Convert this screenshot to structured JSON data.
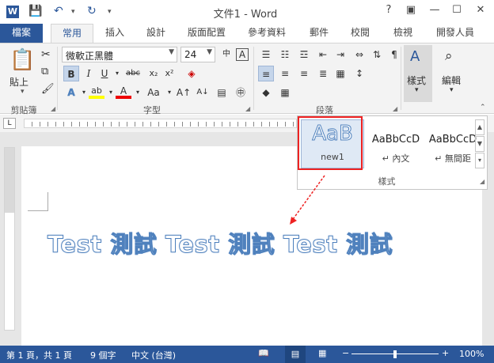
{
  "titlebar": {
    "app_icon": "W",
    "title": "文件1 - Word",
    "help": "?"
  },
  "tabs": [
    "檔案",
    "常用",
    "插入",
    "設計",
    "版面配置",
    "參考資料",
    "郵件",
    "校閱",
    "檢視",
    "開發人員"
  ],
  "clipboard": {
    "paste_label": "貼上",
    "group_label": "剪貼簿"
  },
  "font": {
    "name": "微軟正黑體",
    "size": "24",
    "group_label": "字型",
    "bold": "B",
    "italic": "I",
    "underline": "U",
    "strike": "abc",
    "sub": "x₂",
    "sup": "x²",
    "change_case": "Aa",
    "font_glyph": "A"
  },
  "paragraph": {
    "group_label": "段落"
  },
  "styles": {
    "button_label": "樣式",
    "group_label": "樣式",
    "gallery": [
      {
        "preview": "AaB",
        "name": "new1"
      },
      {
        "preview": "AaBbCcD",
        "name": "↵ 內文"
      },
      {
        "preview": "AaBbCcD",
        "name": "↵ 無間距"
      }
    ]
  },
  "editing": {
    "button_label": "編輯"
  },
  "document": {
    "text": "Test 測試 Test 測試 Test 測試"
  },
  "statusbar": {
    "page": "第 1 頁，共 1 頁",
    "words": "9 個字",
    "language": "中文 (台灣)",
    "zoom": "100%"
  }
}
